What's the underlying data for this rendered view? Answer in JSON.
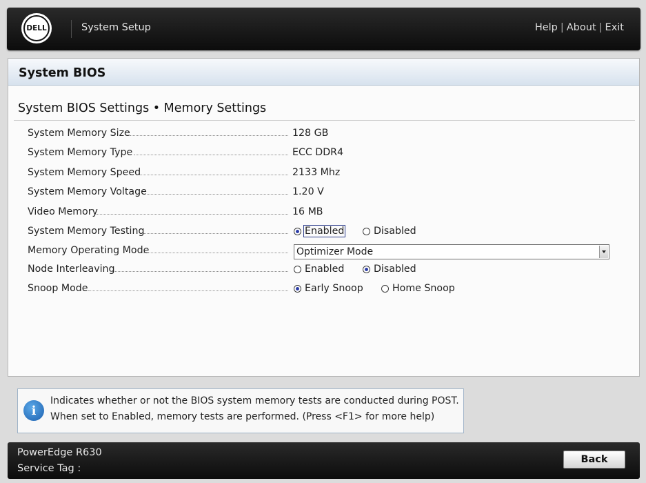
{
  "header": {
    "logo_text": "DELL",
    "title": "System Setup",
    "links": {
      "help": "Help",
      "about": "About",
      "exit": "Exit",
      "separator": "|"
    }
  },
  "page": {
    "title": "System BIOS",
    "section_title": "System BIOS Settings • Memory Settings"
  },
  "settings": {
    "memory_size": {
      "label": "System Memory Size",
      "value": "128 GB"
    },
    "memory_type": {
      "label": "System Memory Type",
      "value": "ECC DDR4"
    },
    "memory_speed": {
      "label": "System Memory Speed",
      "value": "2133 Mhz"
    },
    "memory_voltage": {
      "label": "System Memory Voltage",
      "value": "1.20 V"
    },
    "video_memory": {
      "label": "Video Memory",
      "value": "16 MB"
    },
    "memory_testing": {
      "label": "System Memory Testing",
      "options": [
        "Enabled",
        "Disabled"
      ],
      "selected": "Enabled"
    },
    "operating_mode": {
      "label": "Memory Operating Mode",
      "value": "Optimizer Mode"
    },
    "node_interleaving": {
      "label": "Node Interleaving",
      "options": [
        "Enabled",
        "Disabled"
      ],
      "selected": "Disabled"
    },
    "snoop_mode": {
      "label": "Snoop Mode",
      "options": [
        "Early Snoop",
        "Home Snoop"
      ],
      "selected": "Early Snoop"
    }
  },
  "help": {
    "icon": "info-icon",
    "line1": "Indicates whether or not the BIOS system memory tests are conducted during POST.",
    "line2": "When set to Enabled, memory tests are performed. (Press <F1> for more help)"
  },
  "footer": {
    "model": "PowerEdge R630",
    "service_tag": "Service Tag :",
    "back_label": "Back"
  },
  "colors": {
    "header_bg": "#111111",
    "title_bar": "#d7e2ee",
    "radio_selected": "#2f3fa8",
    "info_icon": "#1b5fae"
  }
}
